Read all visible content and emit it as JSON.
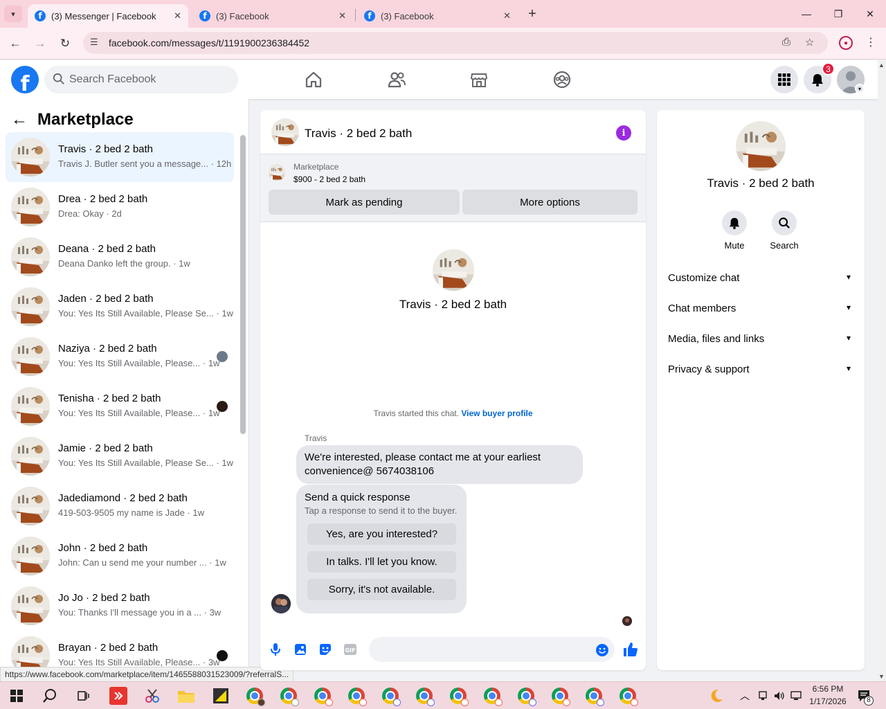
{
  "browser": {
    "tabs": [
      {
        "title": "(3) Messenger | Facebook",
        "active": true
      },
      {
        "title": "(3) Facebook",
        "active": false
      },
      {
        "title": "(3) Facebook",
        "active": false
      }
    ],
    "url": "facebook.com/messages/t/1191900236384452",
    "status_url": "https://www.facebook.com/marketplace/item/1465588031523009/?referralS..."
  },
  "header": {
    "search_placeholder": "Search Facebook",
    "notification_count": "3"
  },
  "sidebar": {
    "title": "Marketplace",
    "conversations": [
      {
        "name": "Travis · 2 bed 2 bath",
        "preview": "Travis J. Butler sent you a message...",
        "time": "12h",
        "active": true,
        "seen": "none"
      },
      {
        "name": "Drea · 2 bed 2 bath",
        "preview": "Drea: Okay",
        "time": "2d",
        "active": false,
        "seen": "none"
      },
      {
        "name": "Deana · 2 bed 2 bath",
        "preview": "Deana Danko left the group.",
        "time": "1w",
        "active": false,
        "seen": "none"
      },
      {
        "name": "Jaden · 2 bed 2 bath",
        "preview": "You: Yes Its Still Available, Please Se...",
        "time": "1w",
        "active": false,
        "seen": "none"
      },
      {
        "name": "Naziya · 2 bed 2 bath",
        "preview": "You: Yes Its Still Available, Please...",
        "time": "1w",
        "active": false,
        "seen": "#6b7a8a"
      },
      {
        "name": "Tenisha · 2 bed 2 bath",
        "preview": "You: Yes Its Still Available, Please...",
        "time": "1w",
        "active": false,
        "seen": "#2a1a14"
      },
      {
        "name": "Jamie · 2 bed 2 bath",
        "preview": "You: Yes Its Still Available, Please Se...",
        "time": "1w",
        "active": false,
        "seen": "none"
      },
      {
        "name": "Jadediamond · 2 bed 2 bath",
        "preview": "419-503-9505 my name is Jade",
        "time": "1w",
        "active": false,
        "seen": "none"
      },
      {
        "name": "John · 2 bed 2 bath",
        "preview": "John: Can u send me your number ...",
        "time": "1w",
        "active": false,
        "seen": "none"
      },
      {
        "name": "Jo Jo · 2 bed 2 bath",
        "preview": "You: Thanks I'll message you in a ...",
        "time": "3w",
        "active": false,
        "seen": "none"
      },
      {
        "name": "Brayan · 2 bed 2 bath",
        "preview": "You: Yes Its Still Available, Please...",
        "time": "3w",
        "active": false,
        "seen": "#111111"
      }
    ]
  },
  "chat": {
    "title": "Travis · 2 bed 2 bath",
    "listing_kind": "Marketplace",
    "listing_price": "$900 - 2 bed 2 bath",
    "mark_pending_label": "Mark as pending",
    "more_options_label": "More options",
    "intro_name": "Travis · 2 bed 2 bath",
    "started_text": "Travis started this chat.",
    "view_buyer_label": "View buyer profile",
    "sender": "Travis",
    "message": "We're interested, please contact me at your earliest convenience@ 5674038106",
    "quick_title": "Send a quick response",
    "quick_subtitle": "Tap a response to send it to the buyer.",
    "quick_responses": [
      "Yes, are you interested?",
      "In talks. I'll let you know.",
      "Sorry, it's not available."
    ]
  },
  "info": {
    "name": "Travis · 2 bed 2 bath",
    "actions": [
      {
        "label": "Mute"
      },
      {
        "label": "Search"
      }
    ],
    "sections": [
      "Customize chat",
      "Chat members",
      "Media, files and links",
      "Privacy & support"
    ]
  },
  "taskbar": {
    "time": "6:56 PM",
    "date": "1/17/2026",
    "notif_count": "8"
  }
}
